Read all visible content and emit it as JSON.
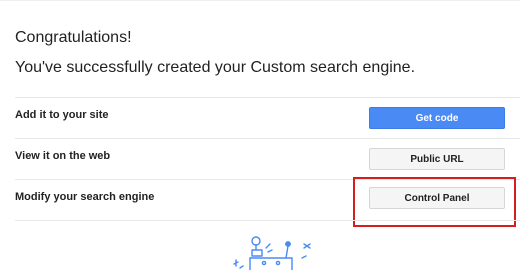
{
  "header": {
    "congrats": "Congratulations!",
    "subtitle": "You've successfully created your Custom search engine."
  },
  "rows": [
    {
      "label": "Add it to your site",
      "button_label": "Get code"
    },
    {
      "label": "View it on the web",
      "button_label": "Public URL"
    },
    {
      "label": "Modify your search engine",
      "button_label": "Control Panel"
    }
  ],
  "colors": {
    "primary_button": "#4a8af4",
    "highlight_border": "#d41f1f",
    "illustration": "#4a8af4"
  },
  "illustration": {
    "icon": "robot-illustration-icon"
  }
}
